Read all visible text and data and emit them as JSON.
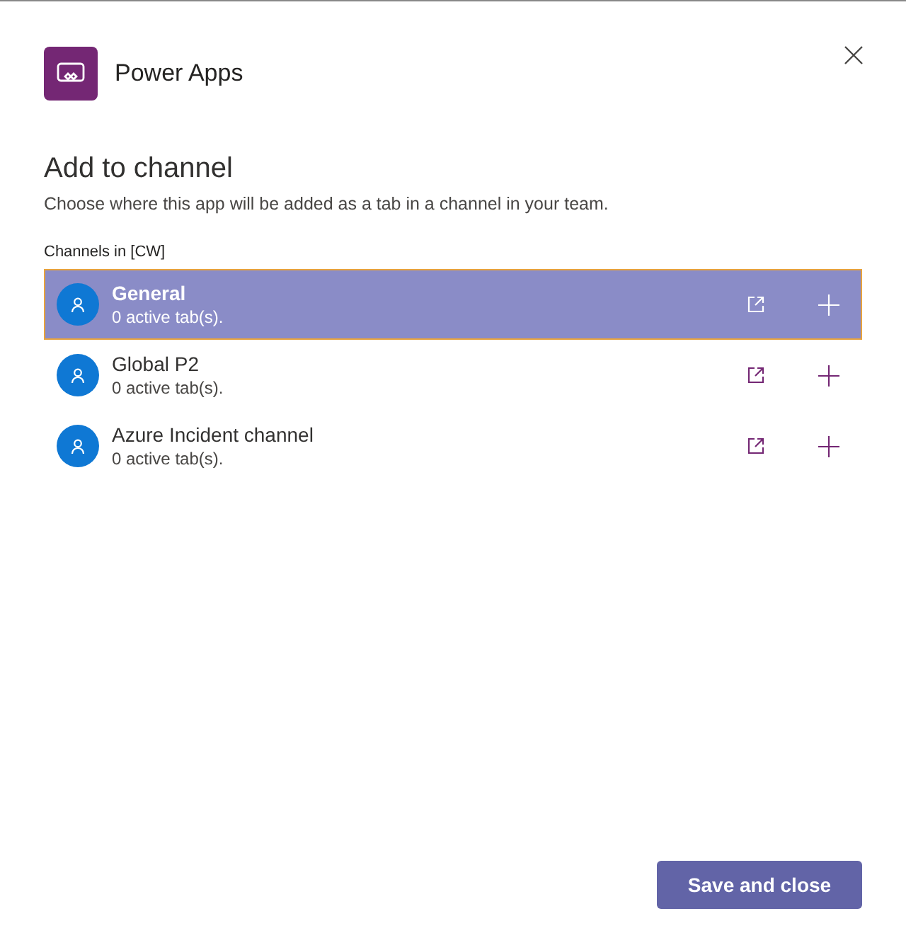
{
  "app": {
    "name": "Power Apps"
  },
  "heading": "Add to channel",
  "description": "Choose where this app will be added as a tab in a channel in your team.",
  "channels_label": "Channels in [CW]",
  "channels": [
    {
      "name": "General",
      "status": "0 active tab(s).",
      "selected": true
    },
    {
      "name": "Global P2",
      "status": "0 active tab(s).",
      "selected": false
    },
    {
      "name": "Azure Incident channel",
      "status": "0 active tab(s).",
      "selected": false
    }
  ],
  "primary_button": "Save and close"
}
